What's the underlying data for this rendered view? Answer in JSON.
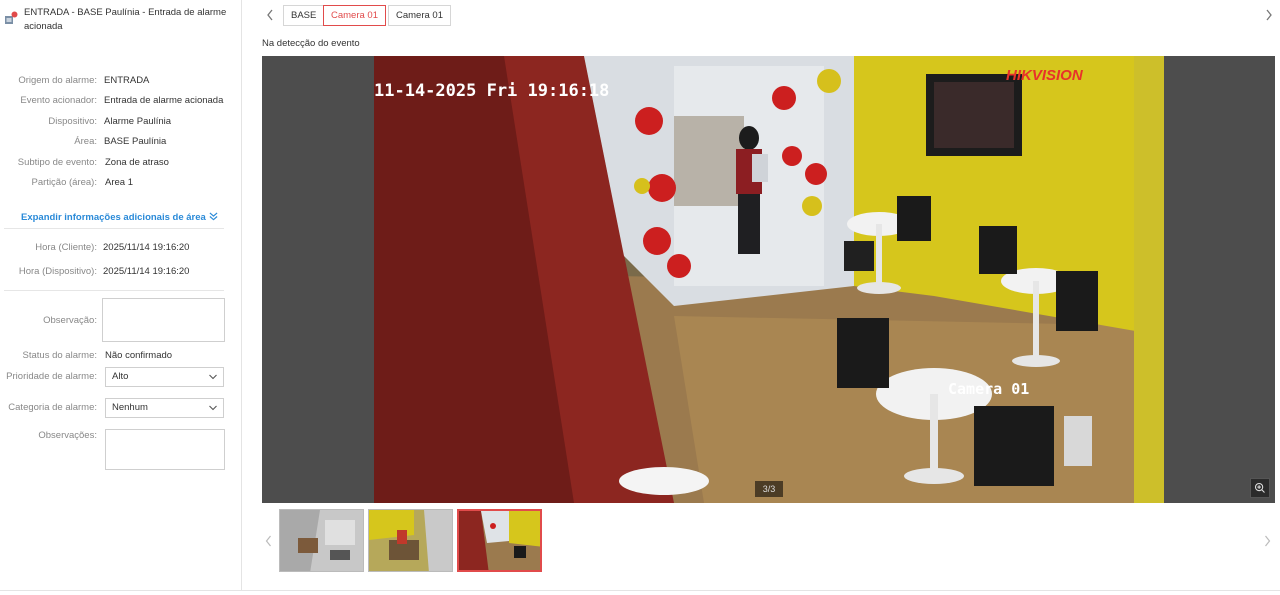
{
  "alarm": {
    "title": "ENTRADA - BASE Paulínia - Entrada de alarme acionada",
    "accent_color": "#e14b4b",
    "link_color": "#2a8ad8"
  },
  "details": [
    {
      "label": "Origem do alarme:",
      "value": "ENTRADA"
    },
    {
      "label": "Evento acionador:",
      "value": "Entrada de alarme acionada"
    },
    {
      "label": "Dispositivo:",
      "value": "Alarme Paulínia"
    },
    {
      "label": "Área:",
      "value": "BASE Paulínia"
    },
    {
      "label": "Subtipo de evento:",
      "value": "Zona de atraso"
    },
    {
      "label": "Partição (área):",
      "value": "Area 1"
    }
  ],
  "expand_label": "Expandir informações adicionais de área",
  "times": [
    {
      "label": "Hora (Cliente):",
      "value": "2025/11/14 19:16:20"
    },
    {
      "label": "Hora (Dispositivo):",
      "value": "2025/11/14 19:16:20"
    }
  ],
  "form": {
    "observacao_label": "Observação:",
    "status_label": "Status do alarme:",
    "status_value": "Não confirmado",
    "priority_label": "Prioridade de alarme:",
    "priority_value": "Alto",
    "category_label": "Categoria de alarme:",
    "category_value": "Nenhum",
    "observacoes_label": "Observações:"
  },
  "tabs": [
    {
      "label": "BASE",
      "active": false
    },
    {
      "label": "Camera 01",
      "active": true
    },
    {
      "label": "Camera 01",
      "active": false
    }
  ],
  "viewer": {
    "caption": "Na detecção do evento",
    "osd_timestamp": "11-14-2025 Fri 19:16:18",
    "osd_camera": "Camera 01",
    "brand": "HIKVISION",
    "counter": "3/3"
  },
  "thumbnails": [
    {
      "active": false
    },
    {
      "active": false
    },
    {
      "active": true
    }
  ]
}
